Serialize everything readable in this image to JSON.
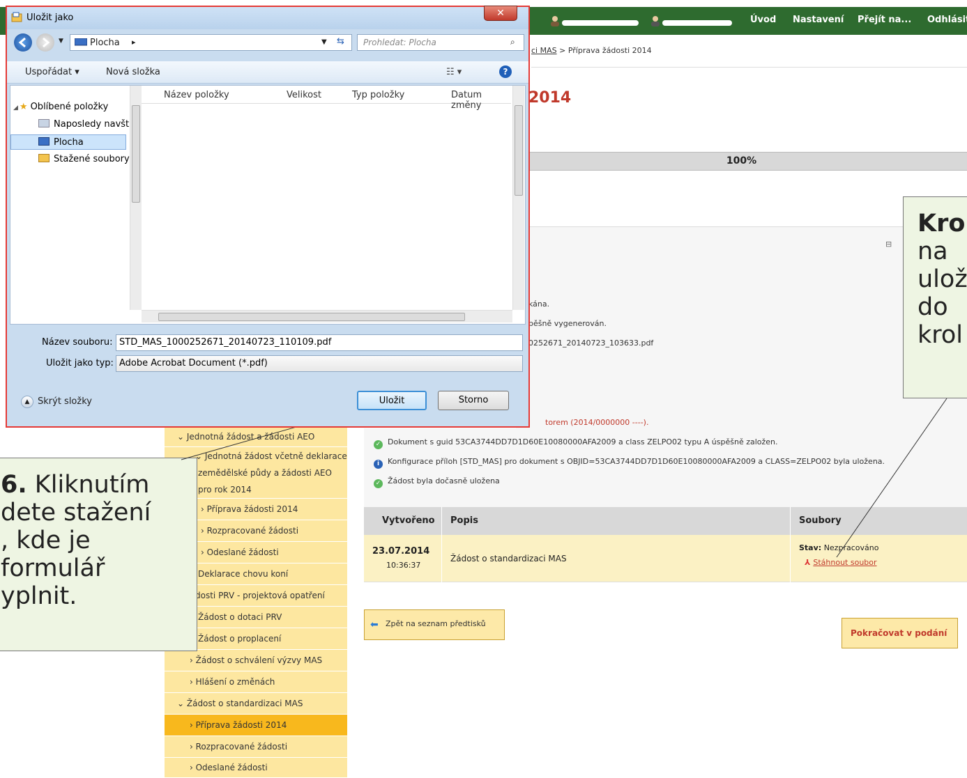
{
  "topnav": {
    "links": [
      "Úvod",
      "Nastavení",
      "Přejít na...",
      "Odhlásit"
    ]
  },
  "breadcrumb": {
    "link": "ci MAS",
    "sep": " > ",
    "current": "Příprava žádosti 2014"
  },
  "page_title": "2014",
  "progress": {
    "label": "100%",
    "value": 1.0
  },
  "messages": [
    {
      "text": "kána.",
      "type": "none"
    },
    {
      "text": "pěšně vygenerován.",
      "type": "none"
    },
    {
      "text": "0252671_20140723_103633.pdf",
      "type": "none"
    },
    {
      "text": "torem (2014/0000000 ----).",
      "type": "none"
    },
    {
      "text": "Dokument s guid 53CA3744DD7D1D60E10080000AFA2009 a class ZELPO02 typu A úspěšně založen.",
      "type": "ok"
    },
    {
      "text": "Konfigurace příloh [STD_MAS] pro dokument s OBJID=53CA3744DD7D1D60E10080000AFA2009 a CLASS=ZELPO02 byla uložena.",
      "type": "info"
    },
    {
      "text": "Žádost byla dočasně uložena",
      "type": "ok"
    }
  ],
  "table": {
    "headers": [
      "Vytvořeno",
      "Popis",
      "Soubory"
    ],
    "row": {
      "date": "23.07.2014",
      "time": "10:36:37",
      "desc": "Žádost o standardizaci MAS",
      "status_label": "Stav:",
      "status_value": "Nezpracováno",
      "download": "Stáhnout soubor"
    }
  },
  "buttons": {
    "back": "Zpět na seznam předtisků",
    "continue": "Pokračovat v podání"
  },
  "sidebar": {
    "items": [
      {
        "label": "Jednotná žádost a žádosti AEO",
        "prefix": "⌄ "
      },
      {
        "label": "Jednotná žádost včetně deklarace",
        "prefix": "⌄ "
      },
      {
        "label": "zemědělské půdy a žádosti AEO",
        "prefix": ""
      },
      {
        "label": "pro rok 2014",
        "prefix": ""
      },
      {
        "label": "Příprava žádosti 2014",
        "prefix": "› "
      },
      {
        "label": "Rozpracované žádosti",
        "prefix": "› "
      },
      {
        "label": "Odeslané žádosti",
        "prefix": "› "
      },
      {
        "label": "Deklarace chovu koní",
        "prefix": ""
      },
      {
        "label": "dosti PRV - projektová opatření",
        "prefix": ""
      },
      {
        "label": "Žádost o dotaci PRV",
        "prefix": ""
      },
      {
        "label": "Žádost o proplacení",
        "prefix": ""
      },
      {
        "label": "Žádost o schválení výzvy MAS",
        "prefix": "› "
      },
      {
        "label": "Hlášení o změnách",
        "prefix": "› "
      },
      {
        "label": "Žádost o standardizaci MAS",
        "prefix": "⌄ "
      },
      {
        "label": "Příprava žádosti 2014",
        "prefix": "› "
      },
      {
        "label": "Rozpracované žádosti",
        "prefix": "› "
      },
      {
        "label": "Odeslané žádosti",
        "prefix": "› "
      }
    ]
  },
  "callout_left": {
    "lines": [
      "6. Kliknutím",
      "dete stažení",
      ", kde je",
      "formulář",
      "yplnit."
    ]
  },
  "callout_right": {
    "lines": [
      "Kro",
      "na ",
      "ulož",
      "do ",
      "krol"
    ]
  },
  "dialog": {
    "title": "Uložit jako",
    "close": "✕",
    "address": "Plocha",
    "search_placeholder": "Prohledat: Plocha",
    "toolbar": {
      "organize": "Uspořádat ▾",
      "new_folder": "Nová složka",
      "view": "☷ ▾",
      "help": "?"
    },
    "tree": [
      "Oblíbené položky",
      "Naposledy navšti",
      "Plocha",
      "Stažené soubory"
    ],
    "columns": [
      "Název položky",
      "Velikost",
      "Typ položky",
      "Datum změny"
    ],
    "filename_label": "Název souboru:",
    "filename_value": "STD_MAS_1000252671_20140723_110109.pdf",
    "type_label": "Uložit jako typ:",
    "type_value": "Adobe Acrobat Document (*.pdf)",
    "hide_folders": "Skrýt složky",
    "save": "Uložit",
    "cancel": "Storno"
  },
  "colors": {
    "nav": "#2e6b2f",
    "accent_red": "#c0392b",
    "sidebar": "#fde7a0",
    "sidebar_active": "#f8b81d",
    "row_bg": "#fbf1c4",
    "callout": "#eef5e3"
  }
}
